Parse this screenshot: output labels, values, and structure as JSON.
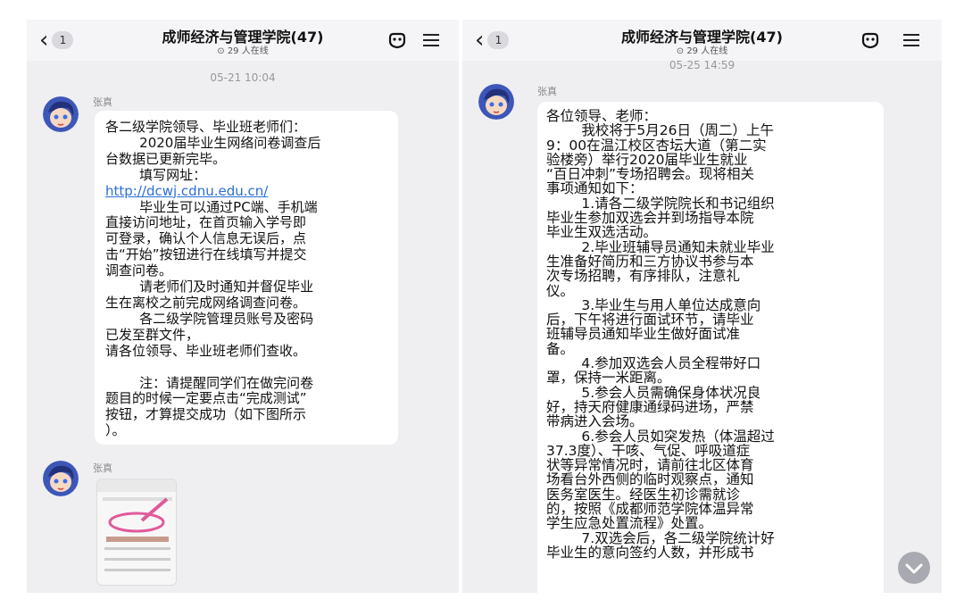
{
  "left": {
    "back_count": "1",
    "title": "成师经济与管理学院(47)",
    "online": "⊙ 29 人在线",
    "timestamp": "05-21 10:04",
    "msg1": {
      "sender": "张真",
      "lines": [
        "各二级学院领导、毕业班老师们：",
        "        2020届毕业生网络问卷调查后",
        "台数据已更新完毕。",
        "        填写网址：",
        "http://dcwj.cdnu.edu.cn/",
        "        毕业生可以通过PC端、手机端",
        "直接访问地址，在首页输入学号即",
        "可登录，确认个人信息无误后，点",
        "击“开始”按钮进行在线填写并提交",
        "调查问卷。",
        "        请老师们及时通知并督促毕业",
        "生在离校之前完成网络调查问卷。",
        "        各二级学院管理员账号及密码",
        "已发至群文件，",
        "请各位领导、毕业班老师们查收。",
        "",
        "        注：请提醒同学们在做完问卷",
        "题目的时候一定要点击“完成测试”",
        "按钮，才算提交成功（如下图所示",
        "）。"
      ]
    },
    "msg2": {
      "sender": "张真"
    }
  },
  "right": {
    "back_count": "1",
    "title": "成师经济与管理学院(47)",
    "online": "⊙ 29 人在线",
    "timestamp": "05-25 14:59",
    "msg1": {
      "sender": "张真",
      "lines": [
        "各位领导、老师：",
        "        我校将于5月26日（周二）上午",
        "9：00在温江校区杏坛大道（第二实",
        "验楼旁）举行2020届毕业生就业",
        "“百日冲刺”专场招聘会。现将相关",
        "事项通知如下：",
        "        1.请各二级学院院长和书记组织",
        "毕业生参加双选会并到场指导本院",
        "毕业生双选活动。",
        "        2.毕业班辅导员通知未就业毕业",
        "生准备好简历和三方协议书参与本",
        "次专场招聘，有序排队，注意礼",
        "仪。",
        "        3.毕业生与用人单位达成意向",
        "后，下午将进行面试环节，请毕业",
        "班辅导员通知毕业生做好面试准",
        "备。",
        "        4.参加双选会人员全程带好口",
        "罩，保持一米距离。",
        "        5.参会人员需确保身体状况良",
        "好，持天府健康通绿码进场，严禁",
        "带病进入会场。",
        "        6.参会人员如突发热（体温超过",
        "37.3度）、干咳、气促、呼吸道症",
        "状等异常情况时，请前往北区体育",
        "场看台外西侧的临时观察点，通知",
        "医务室医生。经医生初诊需就诊",
        "的，按照《成都师范学院体温异常",
        "学生应急处置流程》处置。",
        "        7.双选会后，各二级学院统计好",
        "毕业生的意向签约人数，并形成书"
      ]
    }
  },
  "icons": {
    "back": "chevron-left-icon",
    "group_badge": "group-badge-icon",
    "menu": "hamburger-menu-icon",
    "scroll_down": "chevron-down-icon"
  },
  "colors": {
    "panel_bg": "#efeff2",
    "bubble_bg": "#ffffff",
    "link": "#2b6fd6"
  }
}
